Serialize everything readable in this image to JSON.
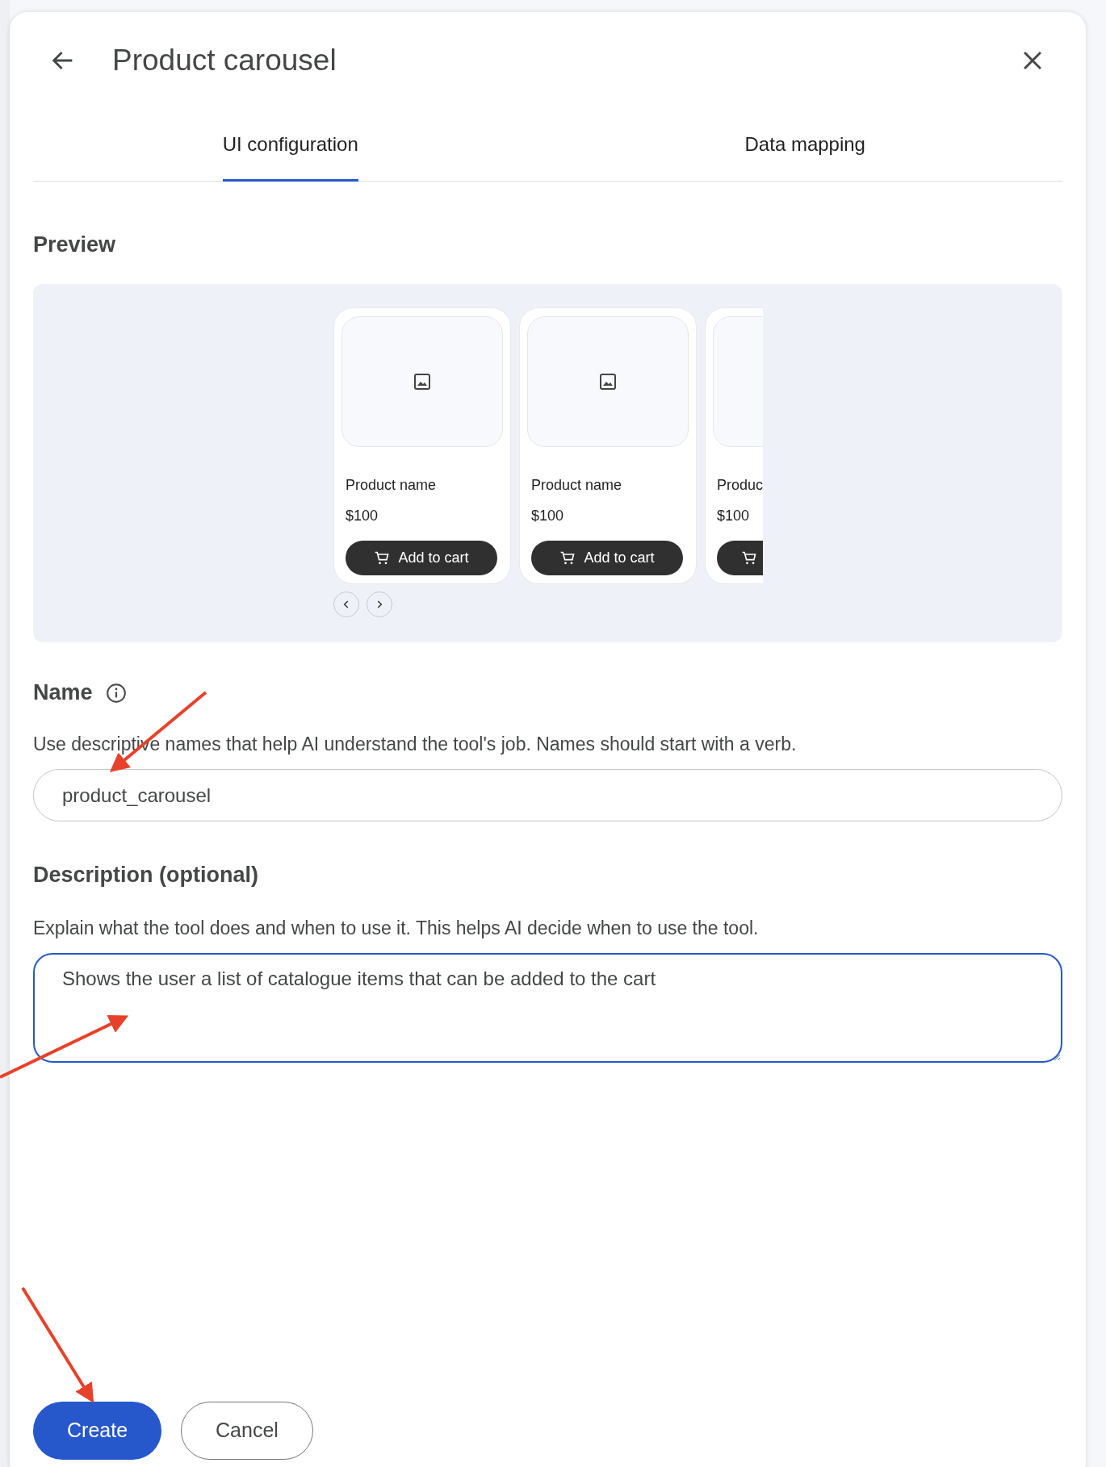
{
  "dialog": {
    "title": "Product carousel"
  },
  "tabs": [
    {
      "label": "UI configuration",
      "selected": true
    },
    {
      "label": "Data mapping",
      "selected": false
    }
  ],
  "preview": {
    "heading": "Preview",
    "cards": [
      {
        "name": "Product name",
        "price": "$100",
        "button": "Add to cart"
      },
      {
        "name": "Product name",
        "price": "$100",
        "button": "Add to cart"
      },
      {
        "name": "Produc",
        "price": "$100"
      }
    ]
  },
  "name_field": {
    "label": "Name",
    "help": "Use descriptive names that help AI understand the tool's job. Names should start with a verb.",
    "value": "product_carousel",
    "focused": false
  },
  "description_field": {
    "label": "Description (optional)",
    "help": "Explain what the tool does and when to use it. This helps AI decide when to use the tool.",
    "value": "Shows the user a list of catalogue items that can be added to the cart",
    "focused": true
  },
  "buttons": [
    {
      "label": "Create",
      "kind": "primary"
    },
    {
      "label": "Cancel",
      "kind": "outline"
    }
  ]
}
